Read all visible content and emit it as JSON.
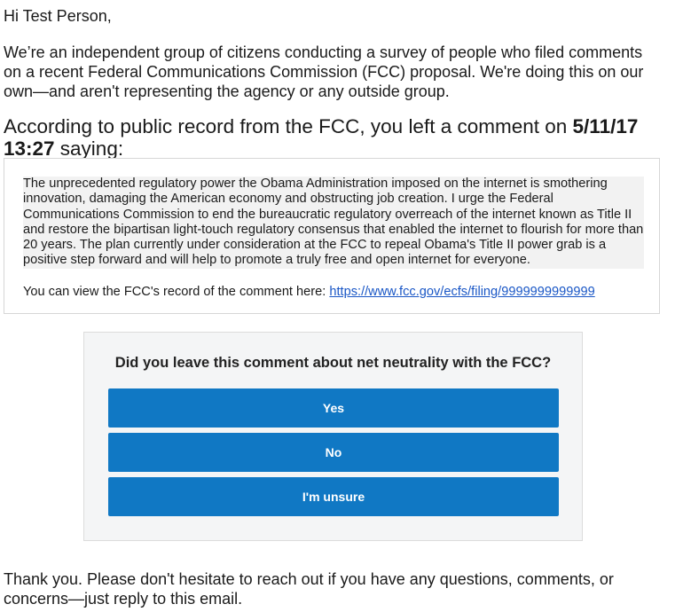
{
  "email": {
    "greeting": "Hi Test Person,",
    "intro": "We’re an independent group of citizens conducting a survey of people who filed comments on a recent Federal Communications Commission (FCC) proposal. We're doing this on our own—and aren't representing the agency or any outside group.",
    "heading_prefix": "According to public record from the FCC, you left a comment on ",
    "heading_datetime": "5/11/17 13:27",
    "heading_suffix": " saying:",
    "comment_text": "The unprecedented regulatory power the Obama Administration imposed on the internet is smothering innovation, damaging the American economy and obstructing job creation. I urge the Federal Communications Commission to end the bureaucratic regulatory overreach of the internet known as Title II and restore the bipartisan light-touch regulatory consensus that enabled the internet to flourish for more than 20 years. The plan currently under consideration at the FCC to repeal Obama's Title II power grab is a positive step forward and will help to promote a truly free and open internet for everyone.",
    "record_label": "You can view the FCC's record of the comment here: ",
    "record_link": "https://www.fcc.gov/ecfs/filing/9999999999999",
    "closing": "Thank you. Please don't hesitate to reach out if you have any questions, comments, or concerns—just reply to this email."
  },
  "survey": {
    "question": "Did you leave this comment about net neutrality with the FCC?",
    "yes_label": "Yes",
    "no_label": "No",
    "unsure_label": "I'm unsure",
    "button_color": "#1078c4"
  }
}
